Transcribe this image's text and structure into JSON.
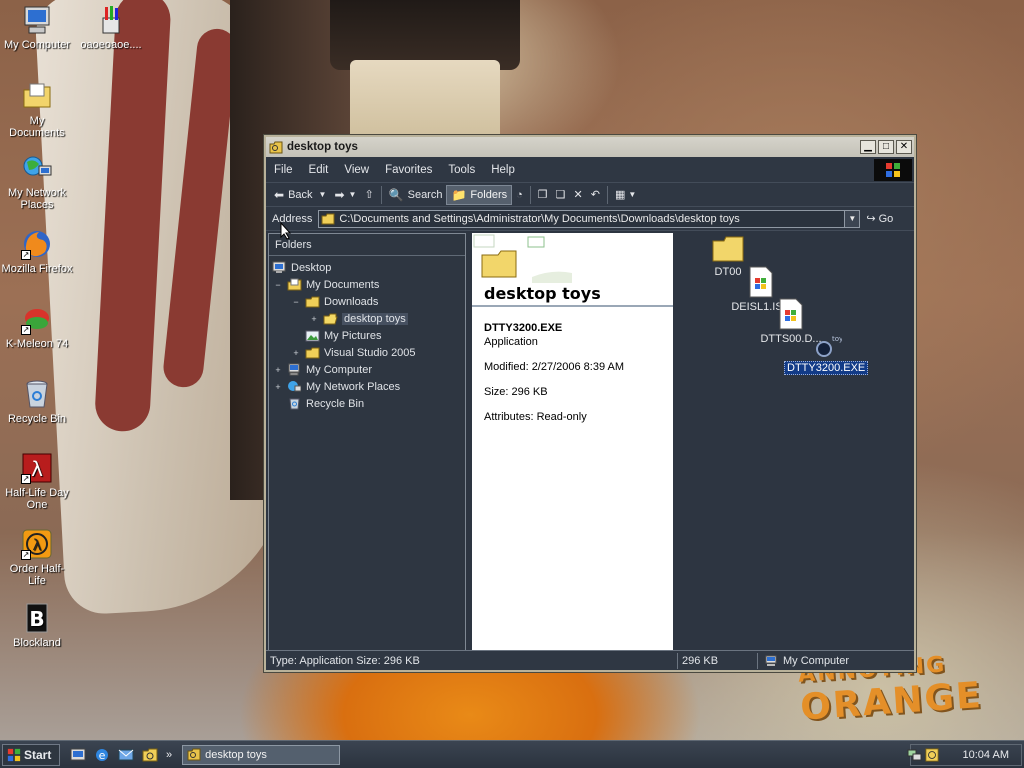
{
  "desktop": {
    "icons": [
      {
        "label": "My Computer"
      },
      {
        "label": "оаоеоаое...."
      },
      {
        "label": "My Documents"
      },
      {
        "label": "My Network Places"
      },
      {
        "label": "Mozilla Firefox"
      },
      {
        "label": "K-Meleon 74"
      },
      {
        "label": "Recycle Bin"
      },
      {
        "label": "Half-Life Day One"
      },
      {
        "label": "Order Half-Life"
      },
      {
        "label": "Blockland"
      }
    ],
    "wallpaper_logo": {
      "line1": "ANNOYING",
      "line2": "ORANGE"
    }
  },
  "window": {
    "title": "desktop toys",
    "menu": [
      "File",
      "Edit",
      "View",
      "Favorites",
      "Tools",
      "Help"
    ],
    "toolbar": {
      "back": "Back",
      "search": "Search",
      "folders": "Folders"
    },
    "address": {
      "label": "Address",
      "value": "C:\\Documents and Settings\\Administrator\\My Documents\\Downloads\\desktop toys",
      "go": "Go"
    },
    "folders_pane": {
      "header": "Folders",
      "tree": [
        {
          "label": "Desktop",
          "expander": ""
        },
        {
          "label": "My Documents",
          "expander": "−"
        },
        {
          "label": "Downloads",
          "expander": "−"
        },
        {
          "label": "desktop toys",
          "expander": "+"
        },
        {
          "label": "My Pictures",
          "expander": ""
        },
        {
          "label": "Visual Studio 2005",
          "expander": "+"
        },
        {
          "label": "My Computer",
          "expander": "+"
        },
        {
          "label": "My Network Places",
          "expander": "+"
        },
        {
          "label": "Recycle Bin",
          "expander": ""
        }
      ]
    },
    "preview": {
      "title": "desktop toys",
      "file_name": "DTTY3200.EXE",
      "file_type": "Application",
      "modified": "Modified: 2/27/2006 8:39 AM",
      "size": "Size: 296 KB",
      "attributes": "Attributes: Read-only"
    },
    "files": [
      {
        "label": "DT00"
      },
      {
        "label": "DEISL1.ISU"
      },
      {
        "label": "DTTS00.D..."
      },
      {
        "label": "DTTY3200.EXE"
      }
    ],
    "status": {
      "info": "Type: Application Size: 296 KB",
      "size": "296 KB",
      "zone": "My Computer"
    }
  },
  "taskbar": {
    "start": "Start",
    "task": "desktop toys",
    "clock": "10:04 AM"
  },
  "colors": {
    "selection": "#123b87",
    "window_bg": "#2d3541",
    "titlebar": "#c4c2b8"
  }
}
